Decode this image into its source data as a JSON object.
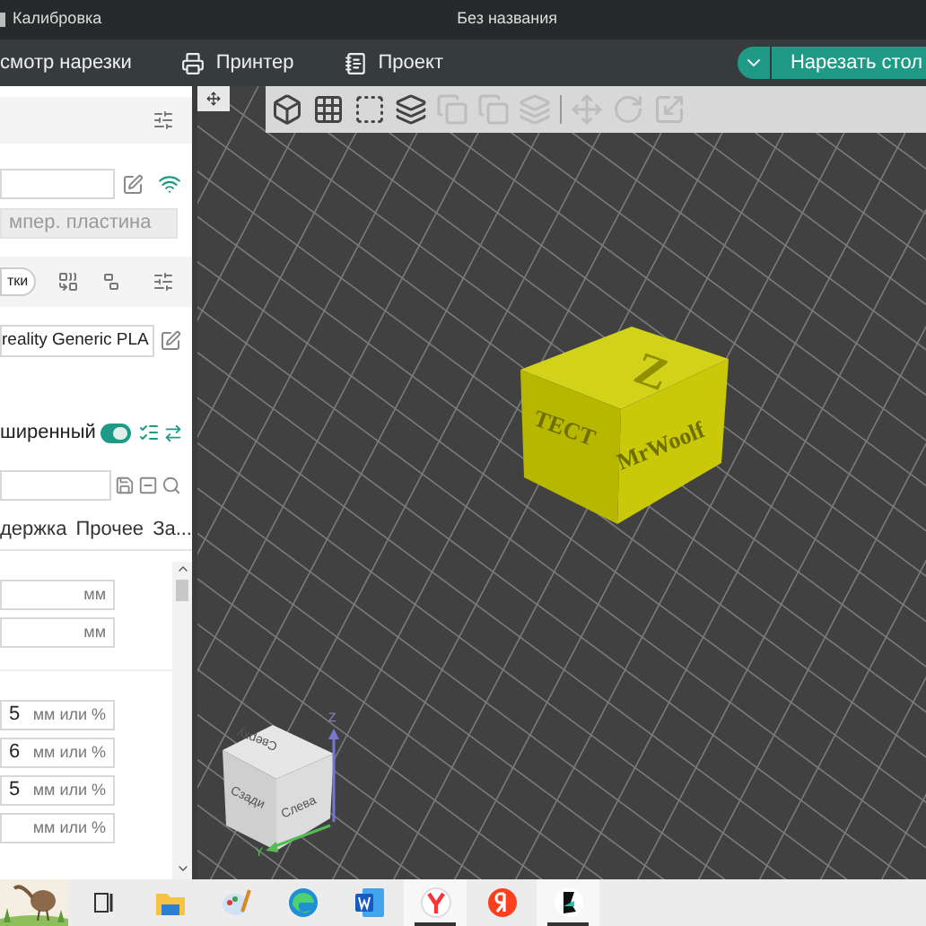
{
  "title_bar": {
    "app_menu": "Калибровка",
    "title": "Без названия"
  },
  "top_tabs": [
    {
      "kind": "preview",
      "label": "смотр нарезки"
    },
    {
      "kind": "printer",
      "label": "Принтер"
    },
    {
      "kind": "project",
      "label": "Проект"
    }
  ],
  "slice_button": {
    "label": "Нарезать стол"
  },
  "left_panel": {
    "plate_field": {
      "value": "мпер. пластина",
      "disabled": true
    },
    "filament_button": "тки",
    "filament_field": "reality Generic PLA",
    "advanced": {
      "label": "ширенный",
      "on": true
    },
    "param_tabs": [
      {
        "label": "держка",
        "selected": false
      },
      {
        "label": "Прочее",
        "selected": false
      },
      {
        "label": "За...",
        "selected": false
      }
    ],
    "param_groups": [
      [
        {
          "unit": "мм"
        },
        {
          "unit": "мм"
        }
      ],
      [
        {
          "value": "5",
          "unit": "мм или %"
        },
        {
          "value": "6",
          "unit": "мм или %"
        },
        {
          "value": "5",
          "unit": "мм или %"
        },
        {
          "unit": "мм или %"
        }
      ]
    ]
  },
  "viewport": {
    "model": {
      "top_text": "Z",
      "side_text": "ТЕСТ",
      "front_text": "MrWoolf"
    },
    "nav_cube": {
      "top": "Сверху",
      "left": "Сзади",
      "right": "Слева",
      "z_axis": "Z",
      "y_axis": "Y"
    }
  },
  "taskbar": [
    {
      "kind": "picture"
    },
    {
      "kind": "task-view",
      "open": false
    },
    {
      "kind": "explorer",
      "open": false
    },
    {
      "kind": "paint",
      "open": false
    },
    {
      "kind": "edge",
      "open": false
    },
    {
      "kind": "word",
      "open": false
    },
    {
      "kind": "yandex-browser",
      "open": true
    },
    {
      "kind": "yandex",
      "open": false
    },
    {
      "kind": "slicer",
      "open": true
    }
  ]
}
